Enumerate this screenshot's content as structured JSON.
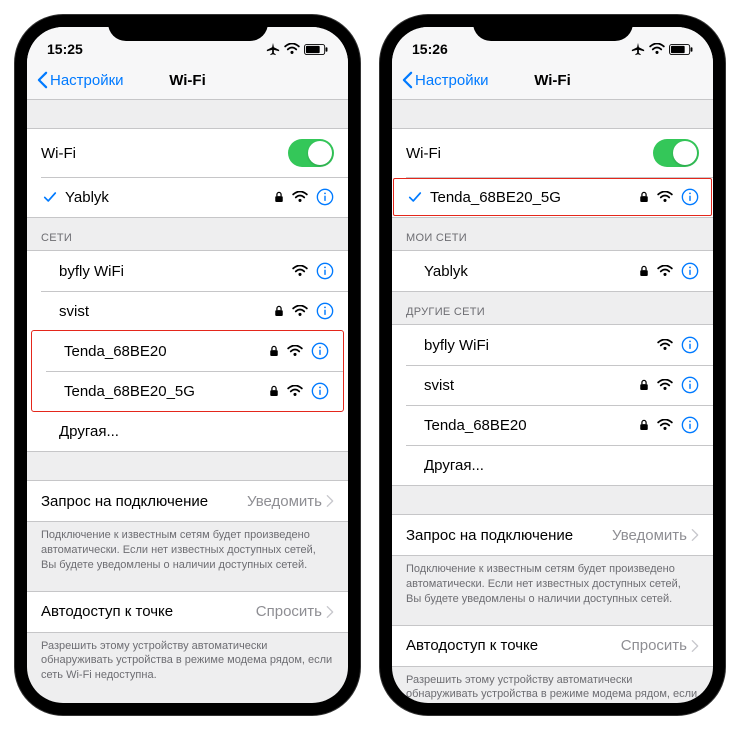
{
  "left": {
    "time": "15:25",
    "back": "Настройки",
    "title": "Wi-Fi",
    "wifi_label": "Wi-Fi",
    "connected": {
      "name": "Yablyk",
      "locked": true
    },
    "networks_header": "СЕТИ",
    "networks": [
      {
        "name": "byfly WiFi",
        "locked": false,
        "info": true
      },
      {
        "name": "svist",
        "locked": true,
        "info": true
      },
      {
        "name": "Tenda_68BE20",
        "locked": true,
        "info": true,
        "hl": true
      },
      {
        "name": "Tenda_68BE20_5G",
        "locked": true,
        "info": true,
        "hl": true
      },
      {
        "name": "Другая...",
        "other": true
      }
    ],
    "ask_label": "Запрос на подключение",
    "ask_value": "Уведомить",
    "ask_footer": "Подключение к известным сетям будет произведено автоматически. Если нет известных доступных сетей, Вы будете уведомлены о наличии доступных сетей.",
    "hotspot_label": "Автодоступ к точке",
    "hotspot_value": "Спросить",
    "hotspot_footer": "Разрешить этому устройству автоматически обнаруживать устройства в режиме модема рядом, если сеть Wi-Fi недоступна."
  },
  "right": {
    "time": "15:26",
    "back": "Настройки",
    "title": "Wi-Fi",
    "wifi_label": "Wi-Fi",
    "connected": {
      "name": "Tenda_68BE20_5G",
      "locked": true
    },
    "my_header": "МОИ СЕТИ",
    "my_networks": [
      {
        "name": "Yablyk",
        "locked": true,
        "info": true
      }
    ],
    "other_header": "ДРУГИЕ СЕТИ",
    "other_networks": [
      {
        "name": "byfly WiFi",
        "locked": false,
        "info": true
      },
      {
        "name": "svist",
        "locked": true,
        "info": true
      },
      {
        "name": "Tenda_68BE20",
        "locked": true,
        "info": true
      },
      {
        "name": "Другая...",
        "other": true
      }
    ],
    "ask_label": "Запрос на подключение",
    "ask_value": "Уведомить",
    "ask_footer": "Подключение к известным сетям будет произведено автоматически. Если нет известных доступных сетей, Вы будете уведомлены о наличии доступных сетей.",
    "hotspot_label": "Автодоступ к точке",
    "hotspot_value": "Спросить",
    "hotspot_footer": "Разрешить этому устройству автоматически обнаруживать устройства в режиме модема рядом, если сеть Wi-Fi недоступна."
  }
}
